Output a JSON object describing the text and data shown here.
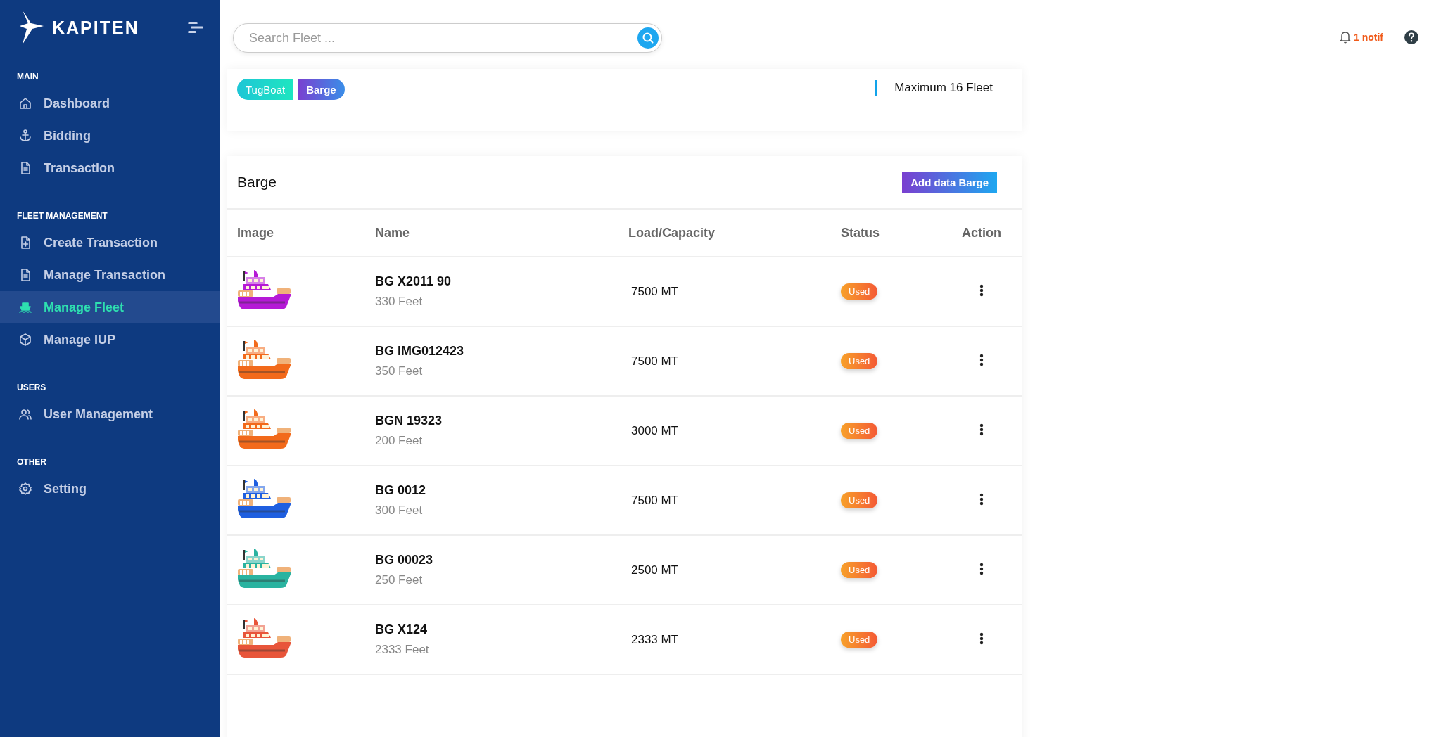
{
  "brand": "KAPITEN",
  "sidebar": {
    "sections": [
      {
        "title": "MAIN",
        "items": [
          {
            "label": "Dashboard",
            "selected": false
          },
          {
            "label": "Bidding",
            "selected": false
          },
          {
            "label": "Transaction",
            "selected": false
          }
        ]
      },
      {
        "title": "FLEET MANAGEMENT",
        "items": [
          {
            "label": "Create Transaction",
            "selected": false
          },
          {
            "label": "Manage Transaction",
            "selected": false
          },
          {
            "label": "Manage Fleet",
            "selected": true
          },
          {
            "label": "Manage IUP",
            "selected": false
          }
        ]
      },
      {
        "title": "USERS",
        "items": [
          {
            "label": "User Management",
            "selected": false
          }
        ]
      },
      {
        "title": "OTHER",
        "items": [
          {
            "label": "Setting",
            "selected": false
          }
        ]
      }
    ]
  },
  "search": {
    "placeholder": "Search Fleet ..."
  },
  "notifications": "1 notif",
  "tabs": [
    {
      "label": "TugBoat",
      "selected": false
    },
    {
      "label": "Barge",
      "selected": true
    }
  ],
  "fleet_limit": "Maximum 16 Fleet",
  "table": {
    "title": "Barge",
    "add_button": "Add data Barge",
    "columns": [
      "Image",
      "Name",
      "Load/Capacity",
      "Status",
      "Action"
    ],
    "rows": [
      {
        "name": "BG X2011 90",
        "length": "330 Feet",
        "capacity": "7500 MT",
        "status": "Used",
        "color": "#b51ad6"
      },
      {
        "name": "BG IMG012423",
        "length": "350 Feet",
        "capacity": "7500 MT",
        "status": "Used",
        "color": "#f26a1b"
      },
      {
        "name": "BGN 19323",
        "length": "200 Feet",
        "capacity": "3000 MT",
        "status": "Used",
        "color": "#f26a1b"
      },
      {
        "name": "BG 0012",
        "length": "300 Feet",
        "capacity": "7500 MT",
        "status": "Used",
        "color": "#1f5fe0"
      },
      {
        "name": "BG 00023",
        "length": "250 Feet",
        "capacity": "2500 MT",
        "status": "Used",
        "color": "#2ab3a0"
      },
      {
        "name": "BG X124",
        "length": "2333 Feet",
        "capacity": "2333 MT",
        "status": "Used",
        "color": "#e8553a"
      }
    ]
  }
}
